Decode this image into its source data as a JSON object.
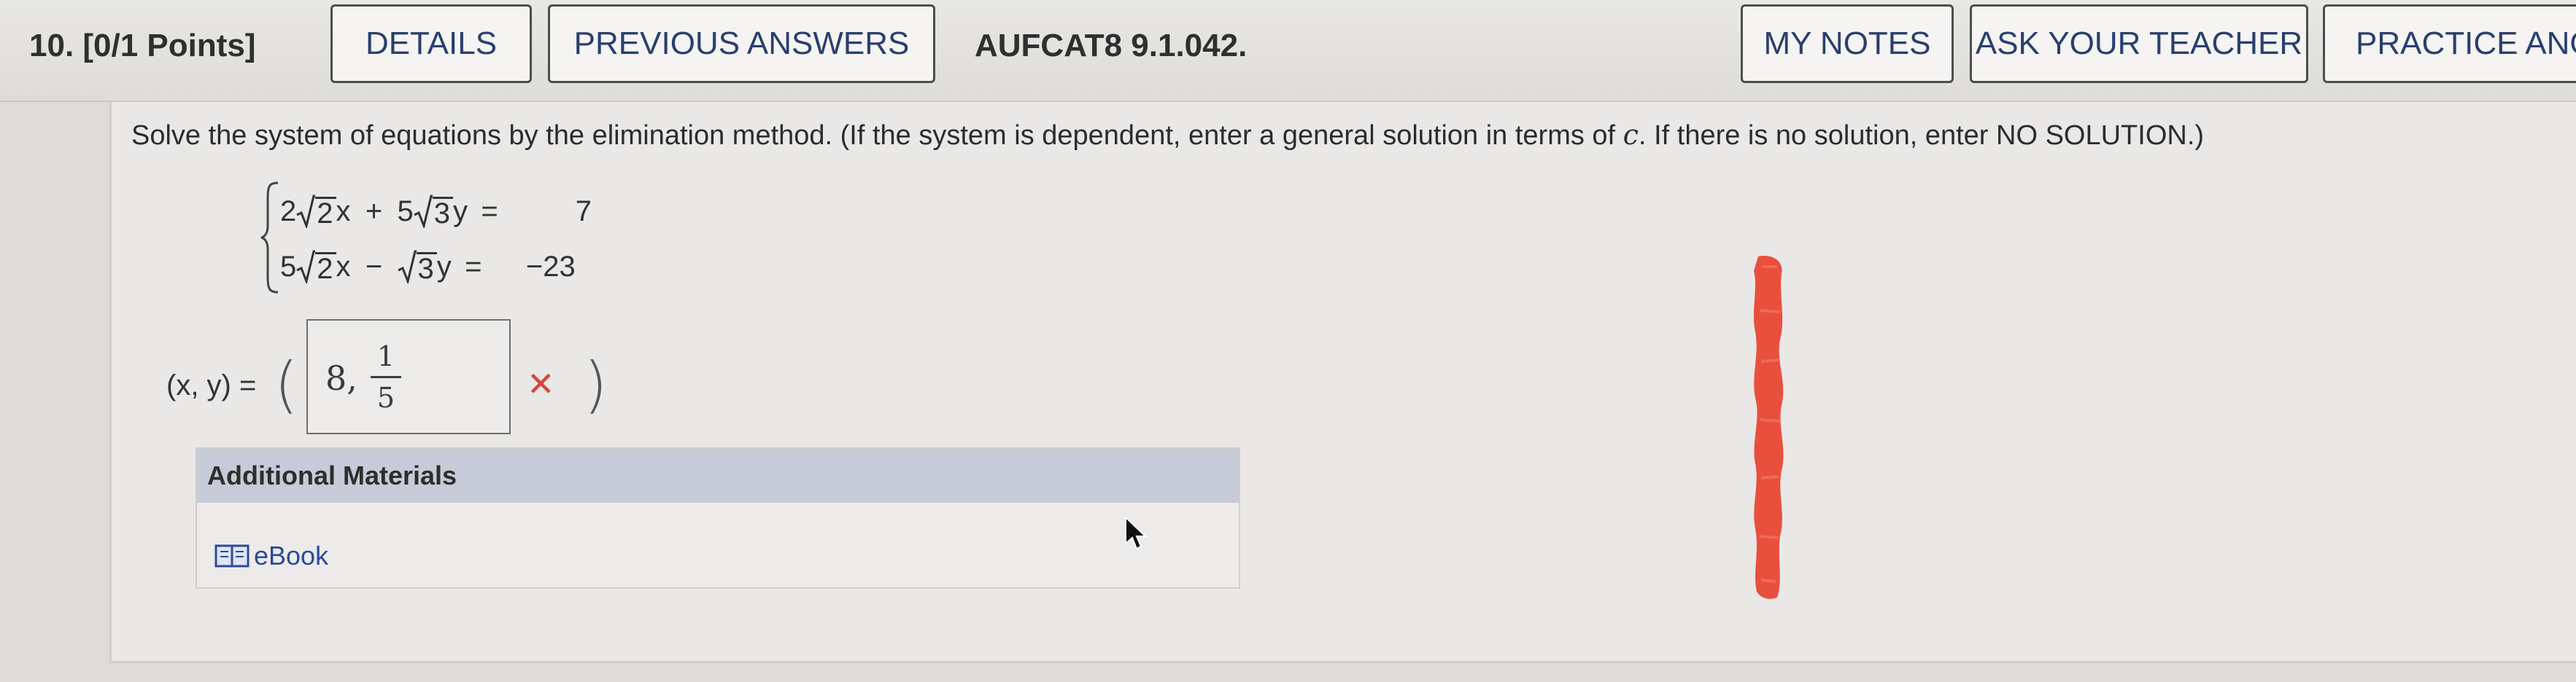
{
  "header": {
    "question_number": "10. [0/1 Points]",
    "details_label": "DETAILS",
    "previous_answers_label": "PREVIOUS ANSWERS",
    "problem_code": "AUFCAT8 9.1.042.",
    "my_notes_label": "MY NOTES",
    "ask_teacher_label": "ASK YOUR TEACHER",
    "practice_label": "PRACTICE ANOTH"
  },
  "question": {
    "instructions_before": "Solve the system of equations by the elimination method. (If the system is dependent, enter a general solution in terms of ",
    "instructions_var": "c",
    "instructions_after": ". If there is no solution, enter NO SOLUTION.)",
    "equations": [
      {
        "coef1": "2",
        "rad1": "2",
        "var1": "x",
        "op": "+",
        "coef2": "5",
        "rad2": "3",
        "var2": "y",
        "eq": "=",
        "rhs": "7"
      },
      {
        "coef1": "5",
        "rad1": "2",
        "var1": "x",
        "op": "−",
        "coef2": "",
        "rad2": "3",
        "var2": "y",
        "eq": "=",
        "rhs": "−23"
      }
    ],
    "answer_label": "(x, y) =",
    "paren_left": "(",
    "paren_right": ")",
    "answer": {
      "integer": "8,",
      "frac_num": "1",
      "frac_den": "5"
    },
    "incorrect_mark": "✕"
  },
  "additional_materials": {
    "heading": "Additional Materials",
    "ebook_label": "eBook"
  },
  "colors": {
    "header_button_text": "#2a3f6e",
    "incorrect": "#d9443a",
    "materials_header": "#c7cbd8",
    "link": "#2b4a9a",
    "scribble": "#e8412f"
  }
}
